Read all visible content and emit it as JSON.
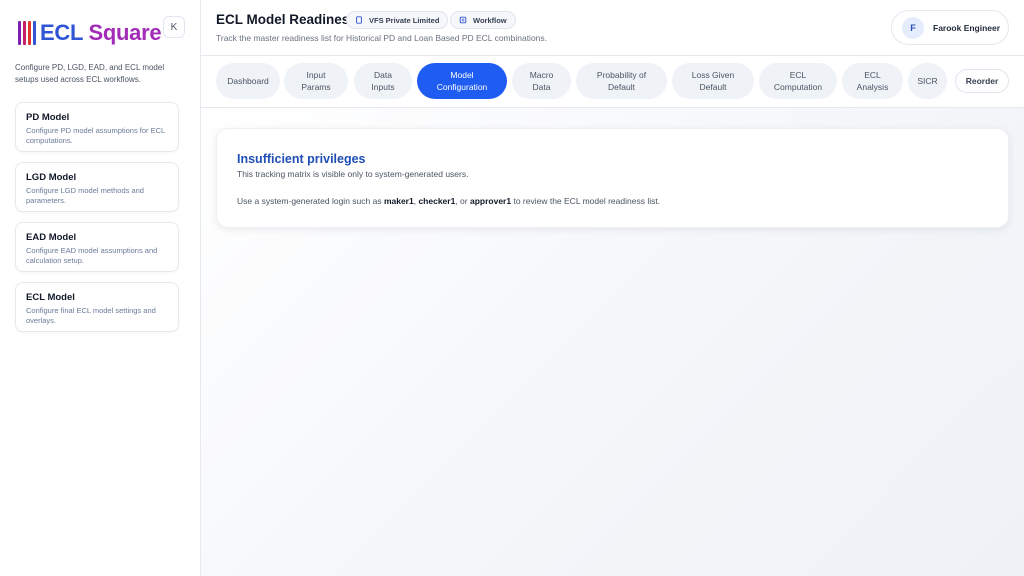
{
  "brand": {
    "name": "ECL Square",
    "name_part1": "ECL",
    "name_part2": "Square",
    "colors": [
      "#7a1fb0",
      "#c42266",
      "#e0362c",
      "#2f55d4"
    ],
    "text_color_1": "#2f55d4",
    "text_color_2": "#a22bb8"
  },
  "sidebar": {
    "collapse_label": "K",
    "description": "Configure PD, LGD, EAD, and ECL model setups used across ECL workflows.",
    "cards": [
      {
        "title": "PD Model",
        "description": "Configure PD model assumptions for ECL computations."
      },
      {
        "title": "LGD Model",
        "description": "Configure LGD model methods and parameters."
      },
      {
        "title": "EAD Model",
        "description": "Configure EAD model assumptions and calculation setup."
      },
      {
        "title": "ECL Model",
        "description": "Configure final ECL model settings and overlays."
      }
    ]
  },
  "header": {
    "title": "ECL Model Readiness",
    "org_chip": "VFS Private Limited",
    "workflow_chip": "Workflow",
    "subtitle": "Track the master readiness list for Historical PD and Loan Based PD ECL combinations.",
    "user": {
      "initial": "F",
      "name": "Farook Engineer"
    }
  },
  "tabs": [
    {
      "label": "Dashboard",
      "active": false
    },
    {
      "label": "Input\nParams",
      "active": false
    },
    {
      "label": "Data\nInputs",
      "active": false
    },
    {
      "label": "Model\nConfiguration",
      "active": true
    },
    {
      "label": "Macro\nData",
      "active": false
    },
    {
      "label": "Probability of\nDefault",
      "active": false
    },
    {
      "label": "Loss Given\nDefault",
      "active": false
    },
    {
      "label": "ECL\nComputation",
      "active": false
    },
    {
      "label": "ECL\nAnalysis",
      "active": false
    },
    {
      "label": "SICR",
      "active": false
    }
  ],
  "reorder_label": "Reorder",
  "notice": {
    "title": "Insufficient privileges",
    "line1": "This tracking matrix is visible only to system-generated users.",
    "line2_prefix": "Use a system-generated login such as ",
    "user1": "maker1",
    "sep1": ", ",
    "user2": "checker1",
    "sep2": ", or ",
    "user3": "approver1",
    "line2_suffix": " to review the ECL model readiness list."
  },
  "accent_color": "#1f5cf2"
}
